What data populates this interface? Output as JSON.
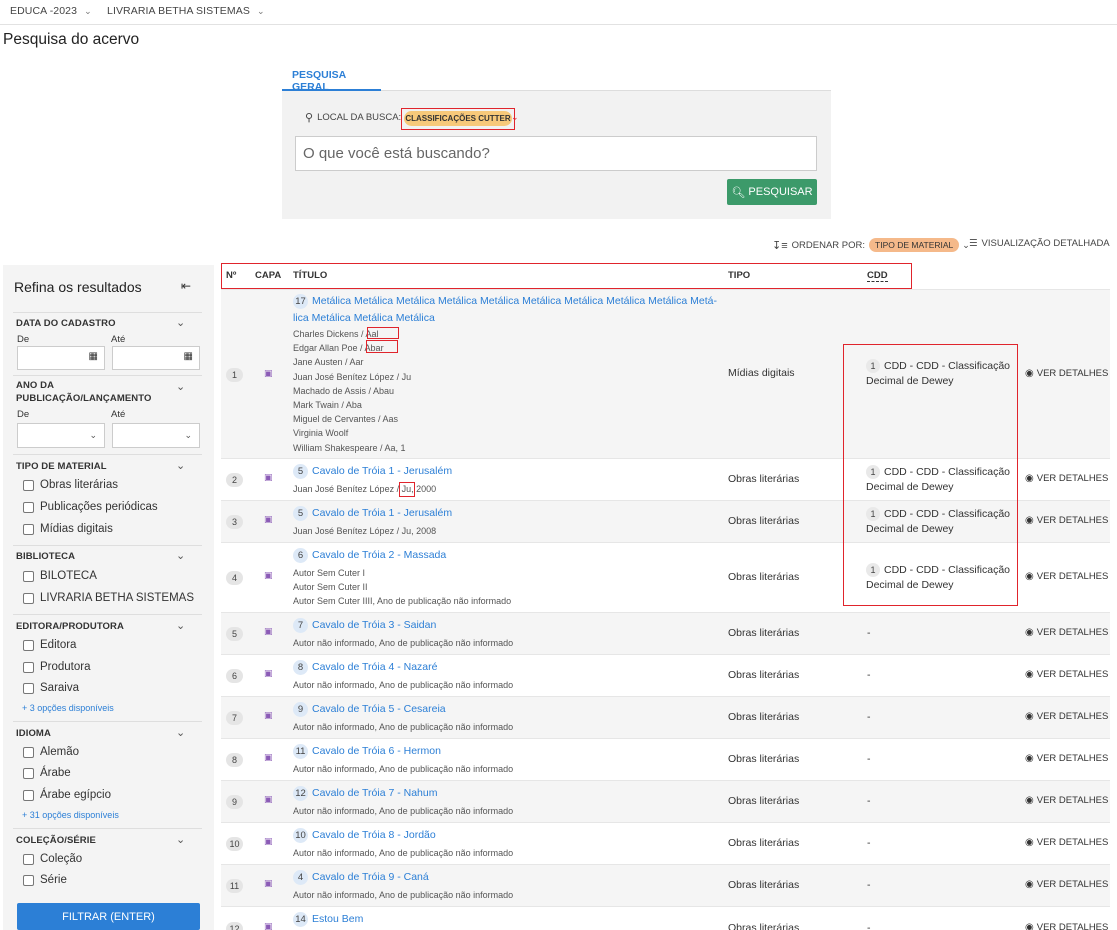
{
  "topbar": {
    "entity": "EDUCA -2023",
    "library": "LIVRARIA BETHA SISTEMAS"
  },
  "page_title": "Pesquisa do acervo",
  "search": {
    "tab_label": "PESQUISA GERAL",
    "local_label": "LOCAL DA BUSCA:",
    "local_value": "CLASSIFICAÇÕES CUTTER",
    "placeholder": "O que você está buscando?",
    "button_label": "PESQUISAR"
  },
  "toolbar": {
    "order_label": "ORDENAR POR:",
    "order_value": "TIPO DE MATERIAL",
    "view_label": "VISUALIZAÇÃO DETALHADA"
  },
  "sidebar": {
    "title": "Refina os resultados",
    "sections": {
      "cadastro": {
        "title": "DATA DO CADASTRO",
        "from": "De",
        "to": "Até"
      },
      "ano": {
        "title_line1": "ANO DA",
        "title_line2": "PUBLICAÇÃO/LANÇAMENTO",
        "from": "De",
        "to": "Até"
      },
      "tipo": {
        "title": "TIPO DE MATERIAL",
        "options": [
          "Obras literárias",
          "Publicações periódicas",
          "Mídias digitais"
        ]
      },
      "biblioteca": {
        "title": "BIBLIOTECA",
        "options": [
          "BILOTECA",
          "LIVRARIA BETHA SISTEMAS"
        ]
      },
      "editora": {
        "title": "EDITORA/PRODUTORA",
        "options": [
          "Editora",
          "Produtora",
          "Saraiva"
        ],
        "more": "+ 3 opções disponíveis"
      },
      "idioma": {
        "title": "IDIOMA",
        "options": [
          "Alemão",
          "Árabe",
          "Árabe egípcio"
        ],
        "more": "+ 31 opções disponíveis"
      },
      "colecao": {
        "title": "COLEÇÃO/SÉRIE",
        "options": [
          "Coleção",
          "Série"
        ]
      }
    },
    "filter_button": "FILTRAR (ENTER)"
  },
  "table": {
    "headers": {
      "num": "Nº",
      "cover": "CAPA",
      "title": "TÍTULO",
      "type": "TIPO",
      "cdd": "CDD"
    },
    "details_label": "VER DETALHES",
    "dash": "-",
    "rows": [
      {
        "num": "1",
        "count": "17",
        "title_line1": "Metálica Metálica Metálica Metálica Metálica Metálica Metálica Metálica Metálica Metá-",
        "title_line2": "lica Metálica Metálica Metálica",
        "authors": [
          "Charles Dickens / Aal",
          "Edgar Allan Poe / Abar",
          "Jane Austen / Aar",
          "Juan José Benítez López / Ju",
          "Machado de Assis / Abau",
          "Mark Twain / Aba",
          "Miguel de Cervantes / Aas",
          "Virginia Woolf",
          "William Shakespeare / Aa, 1"
        ],
        "type": "Mídias digitais",
        "cdd_count": "1",
        "cdd_line1": "CDD - CDD - Classificação",
        "cdd_line2": "Decimal de Dewey"
      },
      {
        "num": "2",
        "count": "5",
        "title": "Cavalo de Tróia 1 - Jerusalém",
        "authors": [
          "Juan José Benítez López / Ju, 2000"
        ],
        "type": "Obras literárias",
        "cdd_count": "1",
        "cdd_line1": "CDD - CDD - Classificação",
        "cdd_line2": "Decimal de Dewey"
      },
      {
        "num": "3",
        "count": "5",
        "title": "Cavalo de Tróia 1 - Jerusalém",
        "authors": [
          "Juan José Benítez López / Ju, 2008"
        ],
        "type": "Obras literárias",
        "cdd_count": "1",
        "cdd_line1": "CDD - CDD - Classificação",
        "cdd_line2": "Decimal de Dewey"
      },
      {
        "num": "4",
        "count": "6",
        "title": "Cavalo de Tróia 2 - Massada",
        "authors": [
          "Autor Sem Cuter I",
          "Autor Sem Cuter II",
          "Autor Sem Cuter IIII, Ano de publicação não informado"
        ],
        "type": "Obras literárias",
        "cdd_count": "1",
        "cdd_line1": "CDD - CDD - Classificação",
        "cdd_line2": "Decimal de Dewey"
      },
      {
        "num": "5",
        "count": "7",
        "title": "Cavalo de Tróia 3 - Saidan",
        "authors": [
          "Autor não informado, Ano de publicação não informado"
        ],
        "type": "Obras literárias"
      },
      {
        "num": "6",
        "count": "8",
        "title": "Cavalo de Tróia 4 - Nazaré",
        "authors": [
          "Autor não informado, Ano de publicação não informado"
        ],
        "type": "Obras literárias"
      },
      {
        "num": "7",
        "count": "9",
        "title": "Cavalo de Tróia 5 - Cesareia",
        "authors": [
          "Autor não informado, Ano de publicação não informado"
        ],
        "type": "Obras literárias"
      },
      {
        "num": "8",
        "count": "11",
        "title": "Cavalo de Tróia 6 - Hermon",
        "authors": [
          "Autor não informado, Ano de publicação não informado"
        ],
        "type": "Obras literárias"
      },
      {
        "num": "9",
        "count": "12",
        "title": "Cavalo de Tróia 7 - Nahum",
        "authors": [
          "Autor não informado, Ano de publicação não informado"
        ],
        "type": "Obras literárias"
      },
      {
        "num": "10",
        "count": "10",
        "title": "Cavalo de Tróia 8 - Jordão",
        "authors": [
          "Autor não informado, Ano de publicação não informado"
        ],
        "type": "Obras literárias"
      },
      {
        "num": "11",
        "count": "4",
        "title": "Cavalo de Tróia 9 - Caná",
        "authors": [
          "Autor não informado, Ano de publicação não informado"
        ],
        "type": "Obras literárias"
      },
      {
        "num": "12",
        "count": "14",
        "title": "Estou Bem",
        "authors": [],
        "type": "Obras literárias"
      }
    ]
  },
  "icons": {
    "search": "magnifier-icon",
    "calendar": "calendar-icon",
    "cover": "image-icon",
    "eye": "eye-icon",
    "sort": "sort-icon",
    "list": "list-icon",
    "collapse": "collapse-arrow-icon"
  },
  "colors": {
    "primary": "#2c7fd6",
    "success": "#3c9a6a",
    "badge": "#f7c97a",
    "order_badge": "#f5b98a",
    "highlight": "#e0242c"
  }
}
